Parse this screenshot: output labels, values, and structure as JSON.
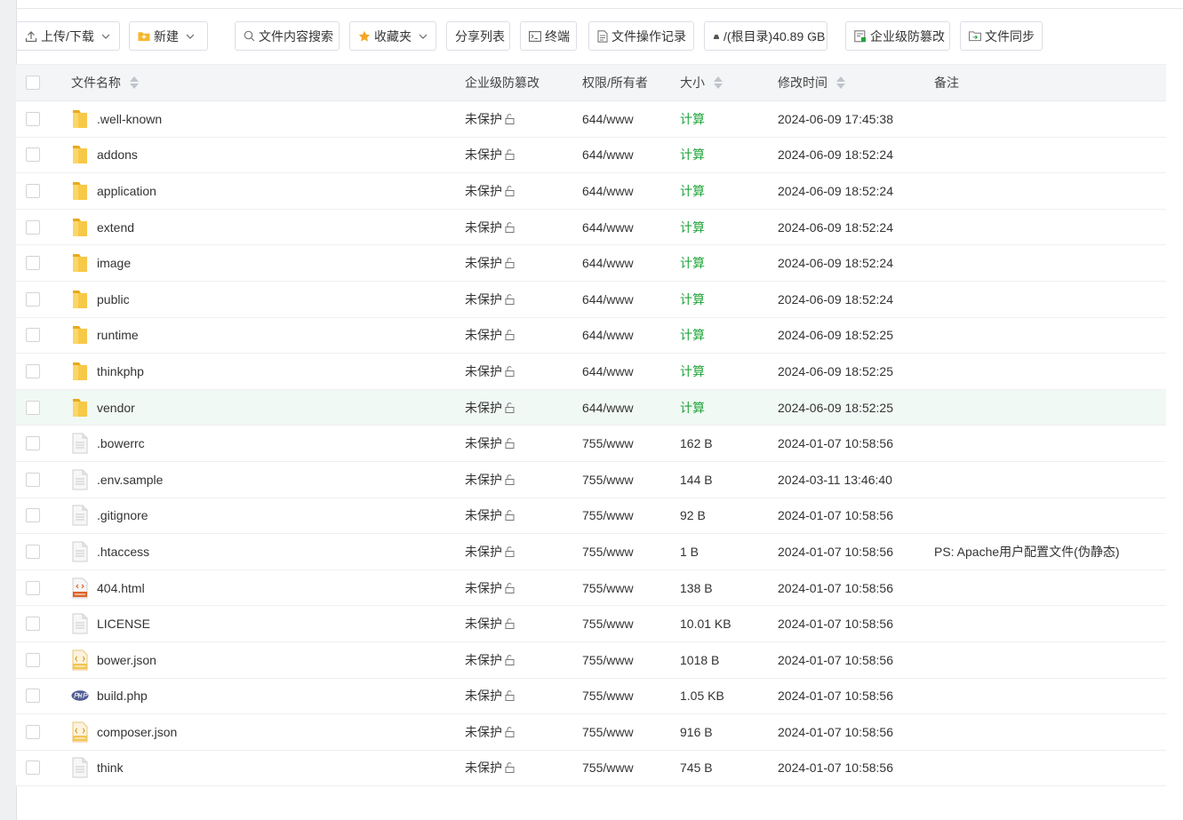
{
  "toolbar": {
    "upload_download": "上传/下载",
    "new": "新建",
    "content_search": "文件内容搜索",
    "favorites": "收藏夹",
    "share_list": "分享列表",
    "terminal": "终端",
    "operation_log": "文件操作记录",
    "disk": "/(根目录)40.89 GB",
    "tamper_proof": "企业级防篡改",
    "file_sync": "文件同步"
  },
  "table": {
    "headers": {
      "name": "文件名称",
      "protection": "企业级防篡改",
      "permission": "权限/所有者",
      "size": "大小",
      "modified": "修改时间",
      "note": "备注"
    },
    "rows": [
      {
        "name": ".well-known",
        "icon": "folder-icon",
        "protection": "未保护",
        "permission": "644/www",
        "size": "计算",
        "modified": "2024-06-09 17:45:38",
        "note": ""
      },
      {
        "name": "addons",
        "icon": "folder-icon",
        "protection": "未保护",
        "permission": "644/www",
        "size": "计算",
        "modified": "2024-06-09 18:52:24",
        "note": ""
      },
      {
        "name": "application",
        "icon": "folder-icon",
        "protection": "未保护",
        "permission": "644/www",
        "size": "计算",
        "modified": "2024-06-09 18:52:24",
        "note": ""
      },
      {
        "name": "extend",
        "icon": "folder-icon",
        "protection": "未保护",
        "permission": "644/www",
        "size": "计算",
        "modified": "2024-06-09 18:52:24",
        "note": ""
      },
      {
        "name": "image",
        "icon": "folder-icon",
        "protection": "未保护",
        "permission": "644/www",
        "size": "计算",
        "modified": "2024-06-09 18:52:24",
        "note": ""
      },
      {
        "name": "public",
        "icon": "folder-icon",
        "protection": "未保护",
        "permission": "644/www",
        "size": "计算",
        "modified": "2024-06-09 18:52:24",
        "note": ""
      },
      {
        "name": "runtime",
        "icon": "folder-icon",
        "protection": "未保护",
        "permission": "644/www",
        "size": "计算",
        "modified": "2024-06-09 18:52:25",
        "note": ""
      },
      {
        "name": "thinkphp",
        "icon": "folder-icon",
        "protection": "未保护",
        "permission": "644/www",
        "size": "计算",
        "modified": "2024-06-09 18:52:25",
        "note": ""
      },
      {
        "name": "vendor",
        "icon": "folder-icon",
        "protection": "未保护",
        "permission": "644/www",
        "size": "计算",
        "modified": "2024-06-09 18:52:25",
        "note": "",
        "highlighted": true
      },
      {
        "name": ".bowerrc",
        "icon": "file-icon",
        "protection": "未保护",
        "permission": "755/www",
        "size": "162 B",
        "modified": "2024-01-07 10:58:56",
        "note": ""
      },
      {
        "name": ".env.sample",
        "icon": "file-icon",
        "protection": "未保护",
        "permission": "755/www",
        "size": "144 B",
        "modified": "2024-03-11 13:46:40",
        "note": ""
      },
      {
        "name": ".gitignore",
        "icon": "file-icon",
        "protection": "未保护",
        "permission": "755/www",
        "size": "92 B",
        "modified": "2024-01-07 10:58:56",
        "note": ""
      },
      {
        "name": ".htaccess",
        "icon": "file-icon",
        "protection": "未保护",
        "permission": "755/www",
        "size": "1 B",
        "modified": "2024-01-07 10:58:56",
        "note": "PS: Apache用户配置文件(伪静态)"
      },
      {
        "name": "404.html",
        "icon": "html-file-icon",
        "protection": "未保护",
        "permission": "755/www",
        "size": "138 B",
        "modified": "2024-01-07 10:58:56",
        "note": ""
      },
      {
        "name": "LICENSE",
        "icon": "file-icon",
        "protection": "未保护",
        "permission": "755/www",
        "size": "10.01 KB",
        "modified": "2024-01-07 10:58:56",
        "note": ""
      },
      {
        "name": "bower.json",
        "icon": "json-file-icon",
        "protection": "未保护",
        "permission": "755/www",
        "size": "1018 B",
        "modified": "2024-01-07 10:58:56",
        "note": ""
      },
      {
        "name": "build.php",
        "icon": "php-file-icon",
        "protection": "未保护",
        "permission": "755/www",
        "size": "1.05 KB",
        "modified": "2024-01-07 10:58:56",
        "note": ""
      },
      {
        "name": "composer.json",
        "icon": "json-file-icon",
        "protection": "未保护",
        "permission": "755/www",
        "size": "916 B",
        "modified": "2024-01-07 10:58:56",
        "note": ""
      },
      {
        "name": "think",
        "icon": "file-icon",
        "protection": "未保护",
        "permission": "755/www",
        "size": "745 B",
        "modified": "2024-01-07 10:58:56",
        "note": ""
      }
    ]
  },
  "icons": {
    "upload": "upload-icon",
    "new": "new-folder-icon",
    "search": "search-icon",
    "favorites": "star-icon",
    "terminal": "terminal-icon",
    "log": "log-icon",
    "disk": "disk-icon",
    "tamper": "shield-doc-icon",
    "sync": "sync-folder-icon",
    "lock": "unlock-icon"
  },
  "colors": {
    "accent_green": "#20a53a",
    "folder_yellow": "#f7c948",
    "row_highlight": "#f1f9f5"
  }
}
